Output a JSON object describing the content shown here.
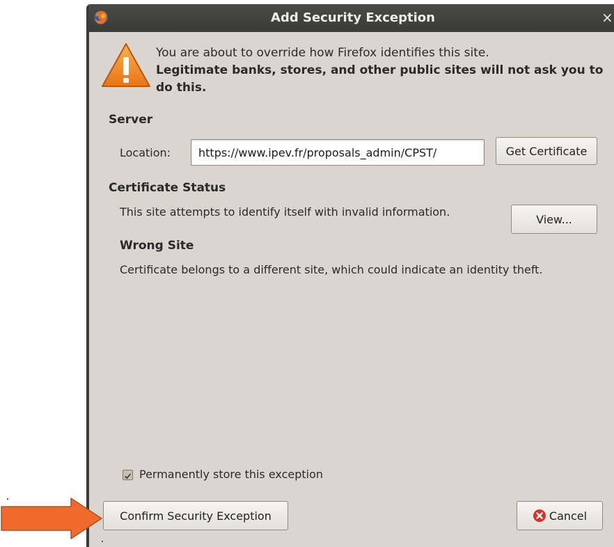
{
  "dialog": {
    "title": "Add Security Exception",
    "intro_line1": "You are about to override how Firefox identifies this site.",
    "intro_line2": "Legitimate banks, stores, and other public sites will not ask you to do this."
  },
  "server": {
    "heading": "Server",
    "location_label": "Location:",
    "location_value": "https://www.ipev.fr/proposals_admin/CPST/",
    "get_certificate_label": "Get Certificate"
  },
  "status": {
    "heading": "Certificate Status",
    "message": "This site attempts to identify itself with invalid information.",
    "view_label": "View...",
    "problem_heading": "Wrong Site",
    "problem_description": "Certificate belongs to a different site, which could indicate an identity theft."
  },
  "options": {
    "permanent_label": "Permanently store this exception",
    "permanent_checked": true
  },
  "footer": {
    "confirm_label": "Confirm Security Exception",
    "cancel_label": "Cancel"
  },
  "annotation": {
    "arrow_color": "#f06a2e"
  }
}
